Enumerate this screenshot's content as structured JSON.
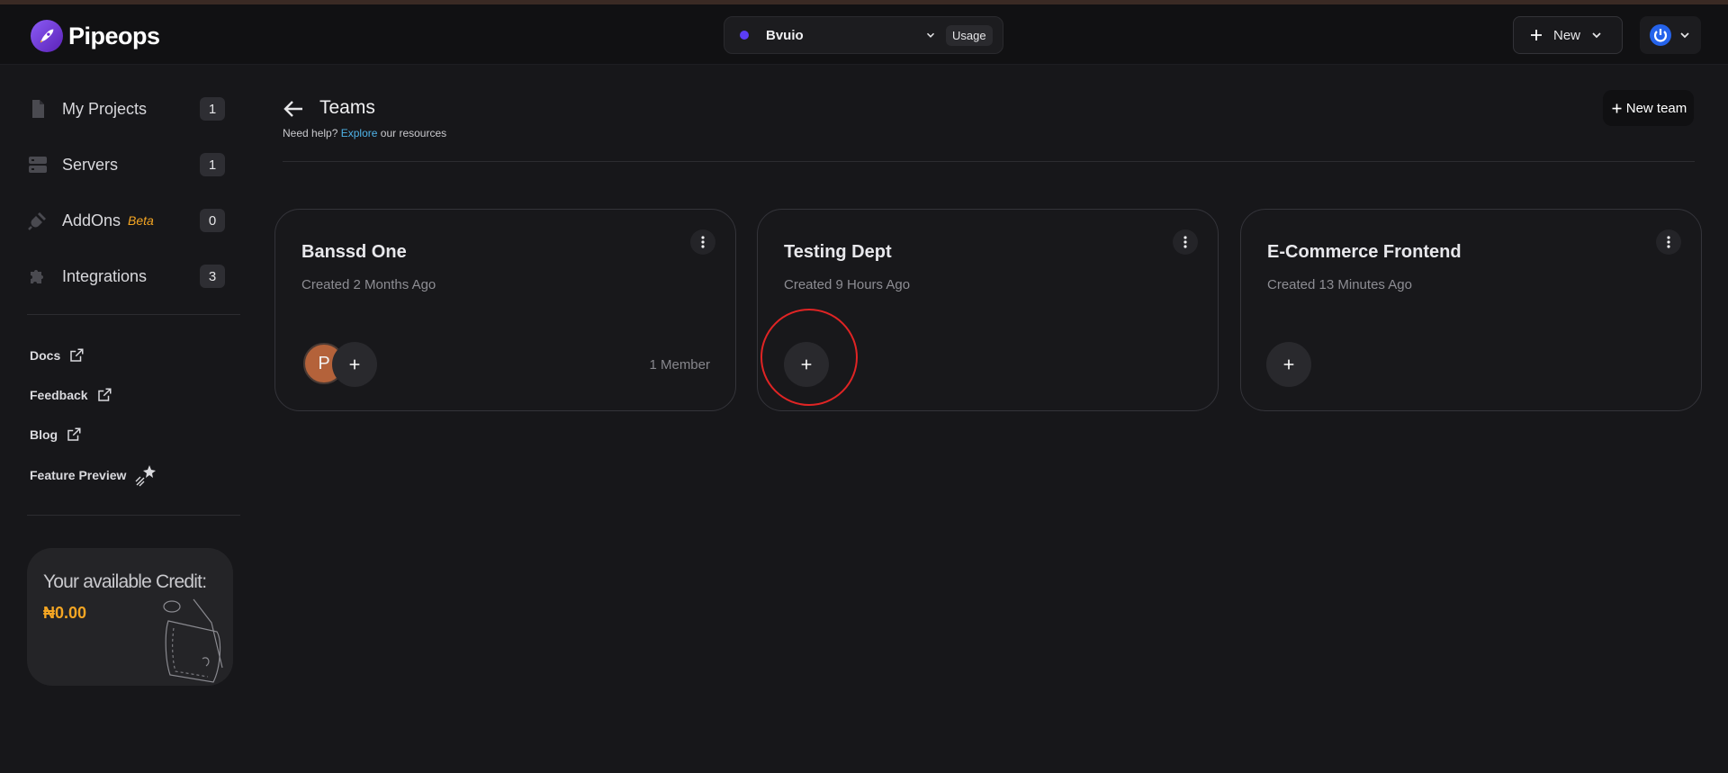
{
  "header": {
    "app_name": "Pipeops",
    "project": {
      "name": "Bvuio",
      "usage_label": "Usage"
    },
    "new_button": "New"
  },
  "sidebar": {
    "items": [
      {
        "label": "My Projects",
        "count": "1",
        "icon": "file-icon"
      },
      {
        "label": "Servers",
        "count": "1",
        "icon": "server-icon"
      },
      {
        "label": "AddOns",
        "badge": "Beta",
        "count": "0",
        "icon": "plug-icon"
      },
      {
        "label": "Integrations",
        "count": "3",
        "icon": "puzzle-icon"
      }
    ],
    "links": [
      {
        "label": "Docs",
        "icon": "external-link-icon"
      },
      {
        "label": "Feedback",
        "icon": "external-link-icon"
      },
      {
        "label": "Blog",
        "icon": "external-link-icon"
      },
      {
        "label": "Feature Preview",
        "icon": "sparkle-icon"
      }
    ],
    "credit": {
      "title": "Your available Credit:",
      "amount": "₦0.00"
    }
  },
  "main": {
    "title": "Teams",
    "help": {
      "prefix": "Need help?",
      "link": "Explore",
      "suffix": "our resources"
    },
    "new_team_button": "New team",
    "teams": [
      {
        "name": "Banssd One",
        "created": "Created 2 Months Ago",
        "avatar_initial": "P",
        "members": "1 Member"
      },
      {
        "name": "Testing Dept",
        "created": "Created 9 Hours Ago"
      },
      {
        "name": "E-Commerce Frontend",
        "created": "Created 13 Minutes Ago"
      }
    ]
  },
  "colors": {
    "background": "#17171a",
    "accent": "#f5a623",
    "link": "#4fb3e8",
    "highlight": "#e02424",
    "brand": "#7c3aed"
  }
}
